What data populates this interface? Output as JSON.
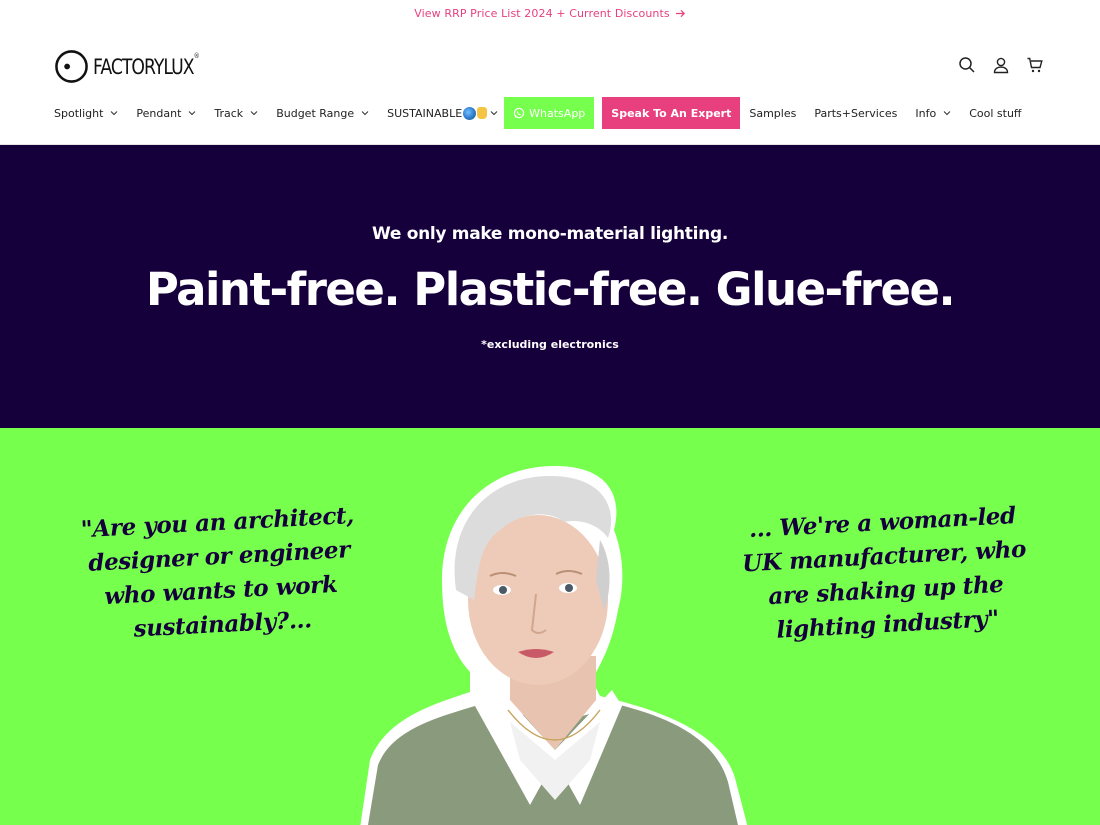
{
  "announcement": {
    "text": "View RRP Price List 2024 + Current Discounts"
  },
  "brand": {
    "name": "FACTORYLUX",
    "reg": "®"
  },
  "header_icons": [
    "search-icon",
    "account-icon",
    "cart-icon"
  ],
  "nav": {
    "spotlight": "Spotlight",
    "pendant": "Pendant",
    "track": "Track",
    "budget": "Budget Range",
    "sustainable": "SUSTAINABLE",
    "whatsapp": "WhatsApp",
    "expert": "Speak To An Expert",
    "samples": "Samples",
    "parts": "Parts+Services",
    "info": "Info",
    "cool": "Cool stuff"
  },
  "hero": {
    "subtitle": "We only make mono-material lighting.",
    "title": "Paint-free. Plastic-free. Glue-free.",
    "note": "*excluding electronics"
  },
  "video": {
    "quote_left": "\"Are you an architect,\ndesigner or engineer\nwho wants to work\nsustainably?...",
    "quote_right": "... We're a woman-led\nUK manufacturer, who\nare shaking up the\nlighting industry\""
  },
  "colors": {
    "accent_pink": "#e8407e",
    "whatsapp_green": "#76ff4d",
    "hero_navy": "#16003b",
    "hero_green": "#76ff4d"
  }
}
